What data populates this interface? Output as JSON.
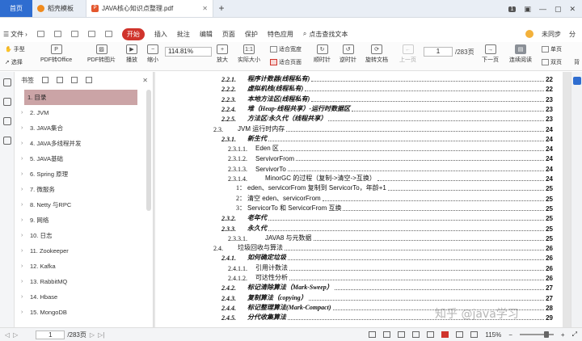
{
  "tabs": {
    "home": "首页",
    "template": "稻壳模板",
    "document": "JAVA核心知识点整理.pdf",
    "add": "+",
    "badge": "1"
  },
  "menu": {
    "file": "文件",
    "start": "开始",
    "items": [
      "插入",
      "批注",
      "编辑",
      "页面",
      "保护",
      "特色应用"
    ],
    "search": "点击查找文本",
    "sync": "未同步",
    "share": "分"
  },
  "toolbar": {
    "hand": "手型",
    "select": "选择",
    "pdf_to_office": "PDF转Office",
    "pdf_to_image": "PDF转图片",
    "play": "播放",
    "shrink": "缩小",
    "zoom": "114.81%",
    "enlarge": "放大",
    "actual_size": "实际大小",
    "fit_width": "适合宽度",
    "fit_page": "适合页面",
    "rotate_cw": "顺时针",
    "rotate_ccw": "逆时针",
    "rotate_doc": "旋转文档",
    "prev_page": "上一页",
    "page_current": "1",
    "page_total": "/283页",
    "next_page": "下一页",
    "continuous": "连续阅读",
    "single": "单页",
    "double": "双页",
    "back": "背"
  },
  "bookmarks": {
    "title": "书签",
    "items": [
      {
        "label": "1. 目录",
        "selected": true
      },
      {
        "label": "2. JVM"
      },
      {
        "label": "3. JAVA集合"
      },
      {
        "label": "4. JAVA多线程并发"
      },
      {
        "label": "5. JAVA基础"
      },
      {
        "label": "6. Spring 原理"
      },
      {
        "label": "7.  微服务"
      },
      {
        "label": "8. Netty 与RPC"
      },
      {
        "label": "9. 网络"
      },
      {
        "label": "10. 日志"
      },
      {
        "label": "11. Zookeeper"
      },
      {
        "label": "12. Kafka"
      },
      {
        "label": "13. RabbitMQ"
      },
      {
        "label": "14. Hbase"
      },
      {
        "label": "15. MongoDB"
      }
    ]
  },
  "toc": [
    {
      "num": "2.2.1.",
      "text": "程序计数器(线程私有)",
      "page": "22",
      "style": "it"
    },
    {
      "num": "2.2.2.",
      "text": "虚拟机栈(线程私有)",
      "page": "22",
      "style": "it"
    },
    {
      "num": "2.2.3.",
      "text": "本地方法区(线程私有)",
      "page": "23",
      "style": "it"
    },
    {
      "num": "2.2.4.",
      "text": "堆（Heap-线程共享）-运行时数据区",
      "page": "23",
      "style": "it"
    },
    {
      "num": "2.2.5.",
      "text": "方法区/永久代（线程共享）",
      "page": "23",
      "style": "it"
    },
    {
      "num": "2.3.",
      "text": "JVM 运行时内存",
      "page": "24",
      "style": "h2"
    },
    {
      "num": "2.3.1.",
      "text": "新生代",
      "page": "24",
      "style": "it"
    },
    {
      "num": "2.3.1.1.",
      "text": "Eden 区",
      "page": "24",
      "style": "h4"
    },
    {
      "num": "2.3.1.2.",
      "text": "ServivorFrom",
      "page": "24",
      "style": "h4"
    },
    {
      "num": "2.3.1.3.",
      "text": "ServivorTo",
      "page": "24",
      "style": "h4"
    },
    {
      "num": "2.3.1.4.",
      "text": "MinorGC 的过程（复制->清空->互换）",
      "page": "24",
      "style": "h4b"
    },
    {
      "num": "1：",
      "text": "eden、servicorFrom 复制到 ServicorTo，年龄+1",
      "page": "25",
      "style": "h5"
    },
    {
      "num": "2：",
      "text": "清空 eden、servicorFrom",
      "page": "25",
      "style": "h5"
    },
    {
      "num": "3：",
      "text": "ServicorTo 和 ServicorFrom 互换",
      "page": "25",
      "style": "h5"
    },
    {
      "num": "2.3.2.",
      "text": "老年代",
      "page": "25",
      "style": "it"
    },
    {
      "num": "2.3.3.",
      "text": "永久代",
      "page": "25",
      "style": "it"
    },
    {
      "num": "2.3.3.1.",
      "text": "JAVA8 与元数据",
      "page": "25",
      "style": "h4b"
    },
    {
      "num": "2.4.",
      "text": "垃圾回收与算法",
      "page": "26",
      "style": "h2"
    },
    {
      "num": "2.4.1.",
      "text": "如何确定垃圾",
      "page": "26",
      "style": "it"
    },
    {
      "num": "2.4.1.1.",
      "text": "引用计数法",
      "page": "26",
      "style": "h4"
    },
    {
      "num": "2.4.1.2.",
      "text": "可达性分析",
      "page": "26",
      "style": "h4"
    },
    {
      "num": "2.4.2.",
      "text": "标记清除算法（Mark-Sweep）",
      "page": "27",
      "style": "it"
    },
    {
      "num": "2.4.3.",
      "text": "复制算法（copying）",
      "page": "27",
      "style": "it"
    },
    {
      "num": "2.4.4.",
      "text": "标记整理算法(Mark-Compact)",
      "page": "28",
      "style": "it"
    },
    {
      "num": "2.4.5.",
      "text": "分代收集算法",
      "page": "29",
      "style": "it"
    }
  ],
  "status": {
    "page_current": "1",
    "page_total": "/283页",
    "zoom": "115%"
  },
  "watermark": "知乎 @java学习",
  "colors": {
    "accent": "#2f6dd0",
    "start": "#d0342c",
    "selected_bookmark": "#cba4a6"
  }
}
